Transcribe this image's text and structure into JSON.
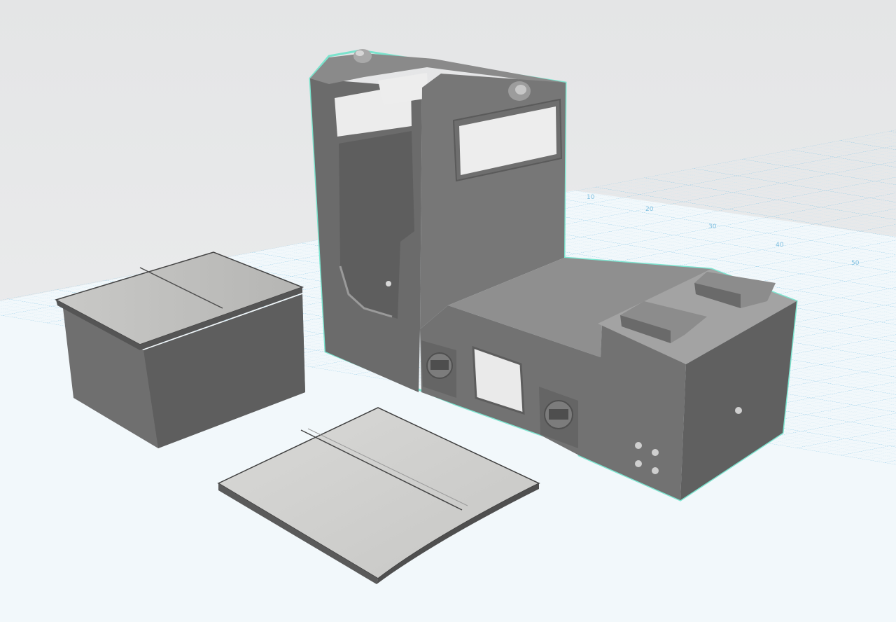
{
  "viewport": {
    "ruler_ticks": [
      "10",
      "20",
      "30",
      "40",
      "50"
    ]
  },
  "scene": {
    "objects": [
      "locomotive-cab-body",
      "hood-box",
      "curved-roof-panel"
    ],
    "selected": "locomotive-cab-body"
  },
  "colors": {
    "grid_major": "#7fc1e3",
    "grid_minor": "#bfe0f0",
    "selection_outline": "#64e0c6",
    "body_dark": "#6a6a6a",
    "body_mid": "#808080",
    "body_light": "#bcbcbc",
    "panel_light": "#d3d3d1"
  }
}
